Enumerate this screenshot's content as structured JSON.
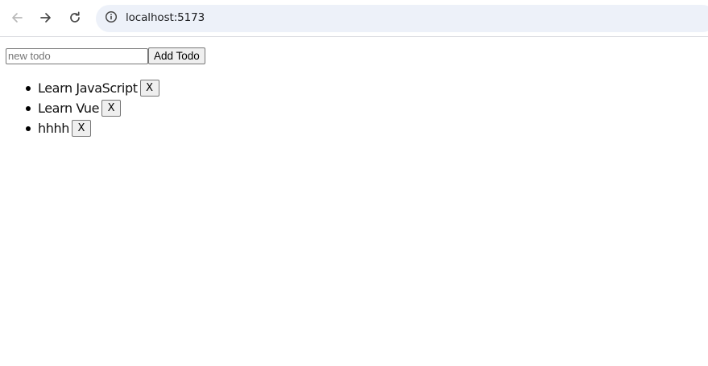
{
  "browser": {
    "url": "localhost:5173",
    "icons": {
      "back": "arrow-left-icon",
      "forward": "arrow-right-icon",
      "reload": "reload-icon",
      "site_info": "info-icon"
    }
  },
  "form": {
    "input_placeholder": "new todo",
    "input_value": "",
    "add_label": "Add Todo"
  },
  "todos": [
    {
      "text": "Learn JavaScript",
      "delete_label": "X"
    },
    {
      "text": "Learn Vue",
      "delete_label": "X"
    },
    {
      "text": "hhhh",
      "delete_label": "X"
    }
  ]
}
